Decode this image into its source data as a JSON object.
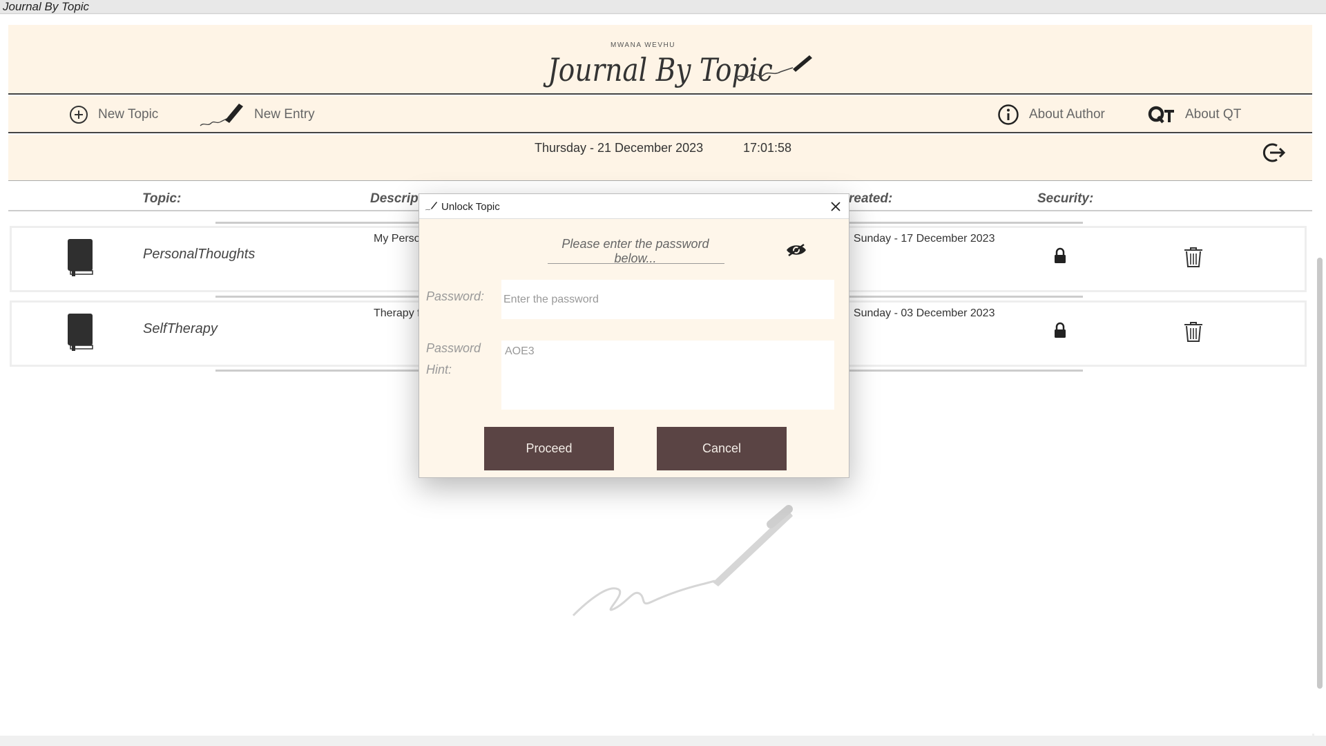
{
  "window": {
    "title": "Journal By Topic"
  },
  "header": {
    "subtitle": "MWANA WEVHU",
    "title": "Journal By Topic"
  },
  "nav": {
    "new_topic": "New Topic",
    "new_entry": "New Entry",
    "about_author": "About Author",
    "about_qt": "About QT"
  },
  "status": {
    "date": "Thursday - 21 December 2023",
    "time": "17:01:58"
  },
  "columns": {
    "topic": "Topic:",
    "description": "Descript",
    "created": "reated:",
    "security": "Security:"
  },
  "topics": [
    {
      "name": "PersonalThoughts",
      "description": "My Persor",
      "created": ": Sunday - 17 December 2023"
    },
    {
      "name": "SelfTherapy",
      "description": "Therapy f",
      "created": ": Sunday - 03 December 2023"
    }
  ],
  "modal": {
    "title": "Unlock Topic",
    "prompt": "Please enter the password below...",
    "password_label": "Password:",
    "password_placeholder": "Enter the password",
    "hint_label_line1": "Password",
    "hint_label_line2": "Hint:",
    "hint_value": "AOE3",
    "proceed": "Proceed",
    "cancel": "Cancel"
  },
  "colors": {
    "cream": "#fef4e6",
    "button": "#5a4444",
    "dark": "#333333"
  },
  "icons": [
    "plus-circle-icon",
    "pen-icon",
    "info-icon",
    "qt-logo-icon",
    "logout-icon",
    "book-icon",
    "lock-icon",
    "trash-icon",
    "eye-icon",
    "close-icon"
  ]
}
